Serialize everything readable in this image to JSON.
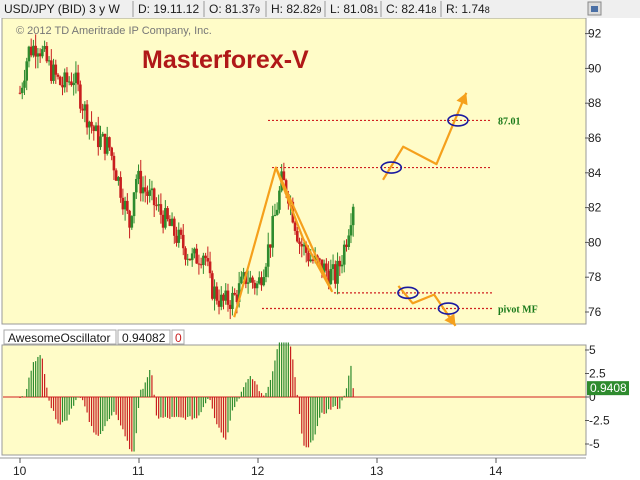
{
  "header": {
    "symbol": "USD/JPY (BID) 3 y W",
    "date": "D: 19.11.12",
    "open": "O: 81.37",
    "open_sub": "9",
    "high": "H: 82.82",
    "high_sub": "9",
    "low": "L: 81.08",
    "low_sub": "1",
    "close": "C: 82.41",
    "close_sub": "8",
    "range": "R: 1.74",
    "range_sub": "8"
  },
  "copyright": "© 2012 TD Ameritrade IP Company, Inc.",
  "title": "Masterforex-V",
  "indicator": {
    "name": "AwesomeOscillator",
    "value": "0.94082",
    "extra": "0",
    "last_badge": "0.9408"
  },
  "colors": {
    "price_bg": "#fffcc8",
    "osc_bg": "#fffcc8",
    "up_candle": "#2e8b2e",
    "down_candle": "#c81e1e",
    "projection": "#f5a01c",
    "level_line": "#d02020",
    "ellipse": "#1a1aa0",
    "zero_line": "#d02020",
    "badge": "#2e8b2e"
  },
  "chart_data": [
    {
      "type": "candlestick",
      "title": "Masterforex-V",
      "series_name": "USD/JPY (BID) 3 y W",
      "x": [
        "10",
        "11",
        "12",
        "13",
        "14"
      ],
      "ylim": [
        74,
        92
      ],
      "yticks": [
        76,
        78,
        80,
        82,
        84,
        86,
        88,
        90,
        92
      ],
      "levels": [
        {
          "value": 87.01,
          "label": "87.01"
        },
        {
          "value": 84.3,
          "label": ""
        },
        {
          "value": 77.1,
          "label": ""
        },
        {
          "value": 76.2,
          "label": "pivot MF"
        }
      ],
      "close_path": [
        {
          "x": 10.0,
          "y": 88.6
        },
        {
          "x": 10.07,
          "y": 91.0
        },
        {
          "x": 10.15,
          "y": 91.4
        },
        {
          "x": 10.25,
          "y": 90.0
        },
        {
          "x": 10.35,
          "y": 89.0
        },
        {
          "x": 10.45,
          "y": 89.5
        },
        {
          "x": 10.55,
          "y": 87.5
        },
        {
          "x": 10.65,
          "y": 86.0
        },
        {
          "x": 10.75,
          "y": 85.5
        },
        {
          "x": 10.85,
          "y": 83.0
        },
        {
          "x": 10.92,
          "y": 81.0
        },
        {
          "x": 10.97,
          "y": 83.8
        },
        {
          "x": 11.05,
          "y": 83.0
        },
        {
          "x": 11.15,
          "y": 82.0
        },
        {
          "x": 11.25,
          "y": 81.0
        },
        {
          "x": 11.35,
          "y": 80.0
        },
        {
          "x": 11.45,
          "y": 79.0
        },
        {
          "x": 11.55,
          "y": 79.5
        },
        {
          "x": 11.6,
          "y": 77.5
        },
        {
          "x": 11.7,
          "y": 76.5
        },
        {
          "x": 11.8,
          "y": 76.8
        },
        {
          "x": 11.9,
          "y": 78.0
        },
        {
          "x": 12.0,
          "y": 77.5
        },
        {
          "x": 12.1,
          "y": 80.0
        },
        {
          "x": 12.2,
          "y": 83.5
        },
        {
          "x": 12.25,
          "y": 83.0
        },
        {
          "x": 12.35,
          "y": 80.0
        },
        {
          "x": 12.45,
          "y": 79.0
        },
        {
          "x": 12.55,
          "y": 78.5
        },
        {
          "x": 12.65,
          "y": 78.0
        },
        {
          "x": 12.7,
          "y": 79.0
        },
        {
          "x": 12.75,
          "y": 80.5
        },
        {
          "x": 12.8,
          "y": 82.4
        }
      ],
      "projection_path": [
        {
          "x": 11.8,
          "y": 75.7
        },
        {
          "x": 12.15,
          "y": 84.3
        },
        {
          "x": 12.62,
          "y": 77.2
        },
        {
          "x": 12.38,
          "y": 80.2
        },
        {
          "x": 12.15,
          "y": 84.3
        }
      ],
      "projection_up": [
        {
          "x": 13.05,
          "y": 83.6
        },
        {
          "x": 13.22,
          "y": 85.5
        },
        {
          "x": 13.5,
          "y": 84.5
        },
        {
          "x": 13.75,
          "y": 88.6
        }
      ],
      "projection_down": [
        {
          "x": 13.18,
          "y": 77.5
        },
        {
          "x": 13.3,
          "y": 76.5
        },
        {
          "x": 13.48,
          "y": 77.0
        },
        {
          "x": 13.66,
          "y": 75.2
        }
      ],
      "markers": [
        {
          "x": 13.12,
          "y": 84.3
        },
        {
          "x": 13.68,
          "y": 87.01
        },
        {
          "x": 13.26,
          "y": 77.1
        },
        {
          "x": 13.6,
          "y": 76.2
        }
      ]
    },
    {
      "type": "bar",
      "title": "AwesomeOscillator",
      "ylim": [
        -6,
        6
      ],
      "yticks": [
        "5",
        "2.5",
        "0",
        "-2.5",
        "-5"
      ],
      "last_value": 0.94082
    }
  ]
}
